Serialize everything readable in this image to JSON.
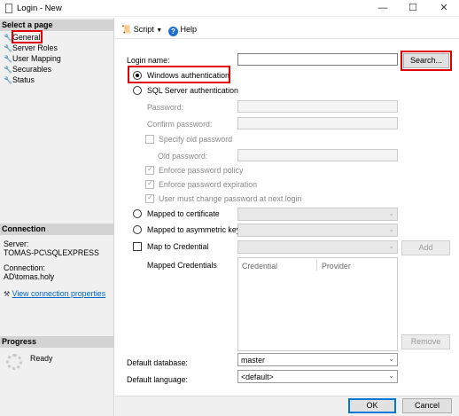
{
  "window": {
    "title": "Login - New",
    "minimize_glyph": "—",
    "maximize_glyph": "☐",
    "close_glyph": "✕"
  },
  "left_pane": {
    "select_page_header": "Select a page",
    "pages": [
      {
        "label": "General",
        "icon": "wrench-icon"
      },
      {
        "label": "Server Roles",
        "icon": "wrench-icon"
      },
      {
        "label": "User Mapping",
        "icon": "wrench-icon"
      },
      {
        "label": "Securables",
        "icon": "wrench-icon"
      },
      {
        "label": "Status",
        "icon": "wrench-icon"
      }
    ],
    "connection_header": "Connection",
    "server_label": "Server:",
    "server_value": "TOMAS-PC\\SQLEXPRESS",
    "connection_label": "Connection:",
    "connection_value": "AD\\tomas.holy",
    "view_properties_link": "View connection properties",
    "progress_header": "Progress",
    "progress_status": "Ready"
  },
  "toolbar": {
    "script_label": "Script",
    "help_label": "Help"
  },
  "form": {
    "login_name_label": "Login name:",
    "login_name_value": "",
    "search_button": "Search...",
    "windows_auth_label": "Windows authentication",
    "sql_auth_label": "SQL Server authentication",
    "password_label": "Password:",
    "confirm_password_label": "Confirm password:",
    "specify_old_password_label": "Specify old password",
    "old_password_label": "Old password:",
    "enforce_policy_label": "Enforce password policy",
    "enforce_expiration_label": "Enforce password expiration",
    "must_change_label": "User must change password at next login",
    "mapped_cert_label": "Mapped to certificate",
    "mapped_asym_label": "Mapped to asymmetric key",
    "map_credential_label": "Map to Credential",
    "add_button": "Add",
    "mapped_credentials_label": "Mapped Credentials",
    "credentials_columns": [
      "Credential",
      "Provider"
    ],
    "remove_button": "Remove",
    "default_database_label": "Default database:",
    "default_database_value": "master",
    "default_language_label": "Default language:",
    "default_language_value": "<default>"
  },
  "footer": {
    "ok_button": "OK",
    "cancel_button": "Cancel"
  },
  "colors": {
    "highlight_red": "#e00000",
    "link_blue": "#0066cc",
    "help_blue": "#1e6fd0",
    "pane_gray": "#f0f0f0",
    "header_gray": "#d3d3d3"
  }
}
